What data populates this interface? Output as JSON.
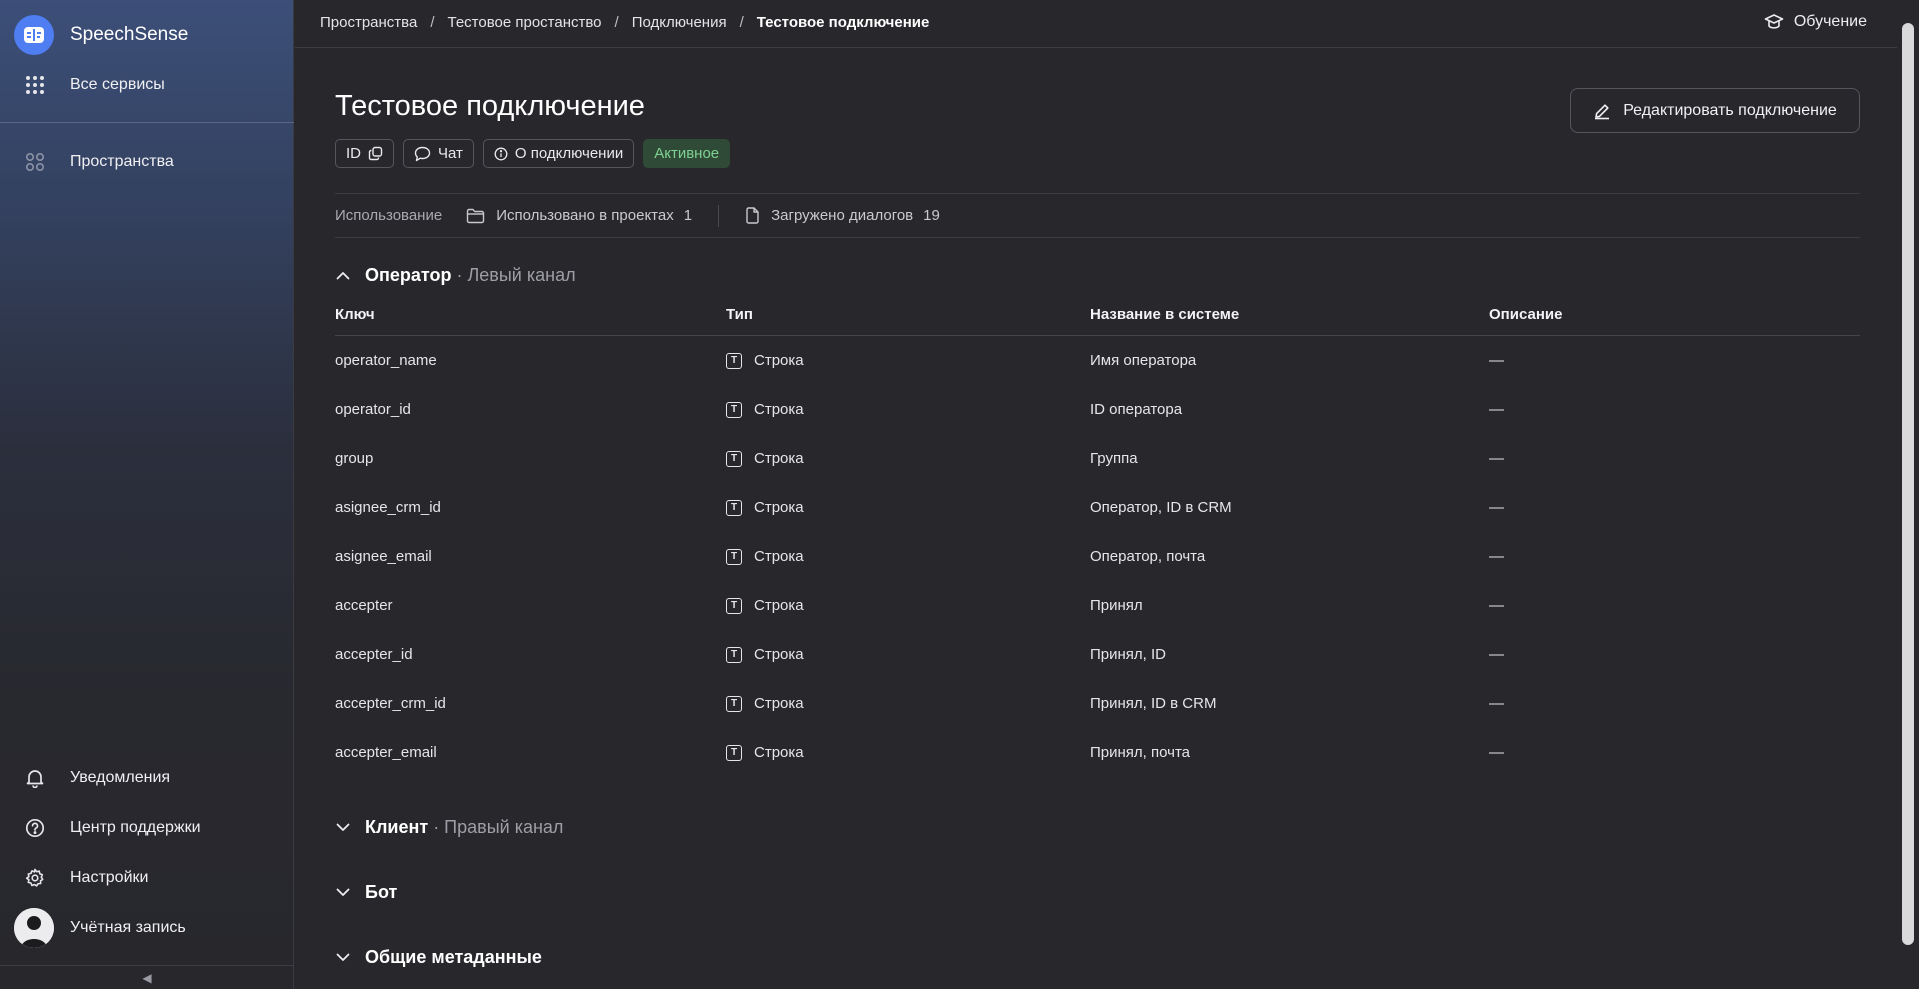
{
  "sidebar": {
    "brand": "SpeechSense",
    "all_services": "Все сервисы",
    "spaces": "Пространства",
    "notifications": "Уведомления",
    "support": "Центр поддержки",
    "settings": "Настройки",
    "account": "Учётная запись",
    "collapse_glyph": "◀"
  },
  "topbar": {
    "breadcrumbs": [
      "Пространства",
      "Тестовое простанство",
      "Подключения",
      "Тестовое подключение"
    ],
    "separator": "/",
    "learning": "Обучение"
  },
  "page": {
    "title": "Тестовое подключение",
    "edit_button": "Редактировать подключение",
    "chips": {
      "id": "ID",
      "chat": "Чат",
      "about": "О подключении",
      "status": "Активное"
    }
  },
  "usage": {
    "label": "Использование",
    "projects_label": "Использовано в проектах",
    "projects_count": "1",
    "dialogs_label": "Загружено диалогов",
    "dialogs_count": "19"
  },
  "sections": {
    "operator": {
      "title": "Оператор",
      "sub": "· Левый канал"
    },
    "client": {
      "title": "Клиент",
      "sub": "· Правый канал"
    },
    "bot": {
      "title": "Бот"
    },
    "meta": {
      "title": "Общие метаданные"
    }
  },
  "table": {
    "headers": [
      "Ключ",
      "Тип",
      "Название в системе",
      "Описание"
    ],
    "rows": [
      {
        "key": "operator_name",
        "type": "Строка",
        "name": "Имя оператора",
        "desc": "—"
      },
      {
        "key": "operator_id",
        "type": "Строка",
        "name": "ID оператора",
        "desc": "—"
      },
      {
        "key": "group",
        "type": "Строка",
        "name": "Группа",
        "desc": "—"
      },
      {
        "key": "asignee_crm_id",
        "type": "Строка",
        "name": "Оператор, ID в CRM",
        "desc": "—"
      },
      {
        "key": "asignee_email",
        "type": "Строка",
        "name": "Оператор, почта",
        "desc": "—"
      },
      {
        "key": "accepter",
        "type": "Строка",
        "name": "Принял",
        "desc": "—"
      },
      {
        "key": "accepter_id",
        "type": "Строка",
        "name": "Принял, ID",
        "desc": "—"
      },
      {
        "key": "accepter_crm_id",
        "type": "Строка",
        "name": "Принял, ID в CRM",
        "desc": "—"
      },
      {
        "key": "accepter_email",
        "type": "Строка",
        "name": "Принял, почта",
        "desc": "—"
      }
    ],
    "type_icon_letter": "T"
  },
  "colors": {
    "background": "#28272c",
    "accent": "#4f7df2",
    "status_bg": "#2f4a36",
    "status_fg": "#7fd193"
  }
}
